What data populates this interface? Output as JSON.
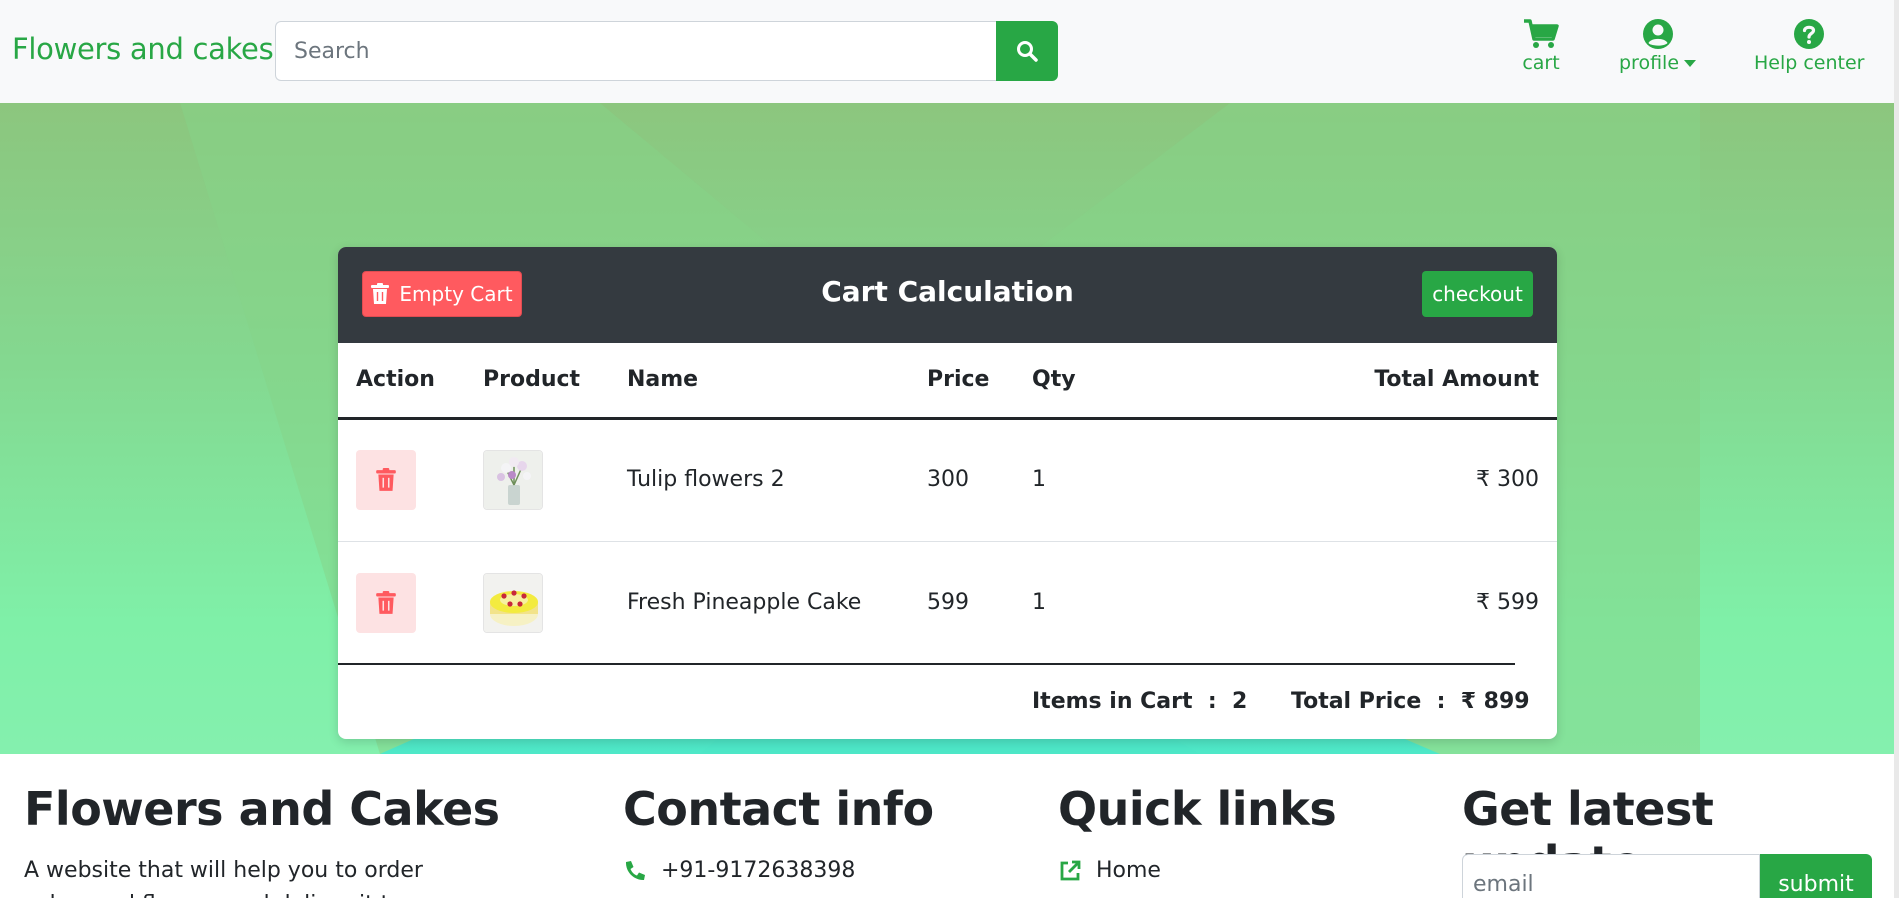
{
  "navbar": {
    "brand": "Flowers and cakes",
    "search_placeholder": "Search",
    "items": [
      {
        "label": "cart",
        "icon": "cart-icon"
      },
      {
        "label": "profile",
        "icon": "user-circle-icon"
      },
      {
        "label": "Help center",
        "icon": "question-circle-icon"
      }
    ]
  },
  "cart": {
    "empty_label": "Empty Cart",
    "title": "Cart Calculation",
    "checkout_label": "checkout",
    "columns": [
      "Action",
      "Product",
      "Name",
      "Price",
      "Qty",
      "Total Amount"
    ],
    "rows": [
      {
        "name": "Tulip flowers 2",
        "price": "300",
        "qty": "1",
        "total": "₹ 300",
        "image": "bouquet-image"
      },
      {
        "name": "Fresh Pineapple Cake",
        "price": "599",
        "qty": "1",
        "total": "₹ 599",
        "image": "cake-image"
      }
    ],
    "items_in_cart_label": "Items in Cart",
    "items_in_cart_value": "2",
    "total_price_label": "Total Price",
    "total_price_value": "₹ 899"
  },
  "footer": {
    "about_title": "Flowers and Cakes",
    "about_text": "A website that will help you to order cakes and flowers and deliver it to",
    "contact_title": "Contact info",
    "phone": "+91-9172638398",
    "links_title": "Quick links",
    "home_link": "Home",
    "update_title": "Get latest update",
    "email_placeholder": "email",
    "submit_label": "submit"
  },
  "colors": {
    "accent": "#28a745",
    "danger": "#ff5a5f",
    "dark": "#343a40"
  }
}
